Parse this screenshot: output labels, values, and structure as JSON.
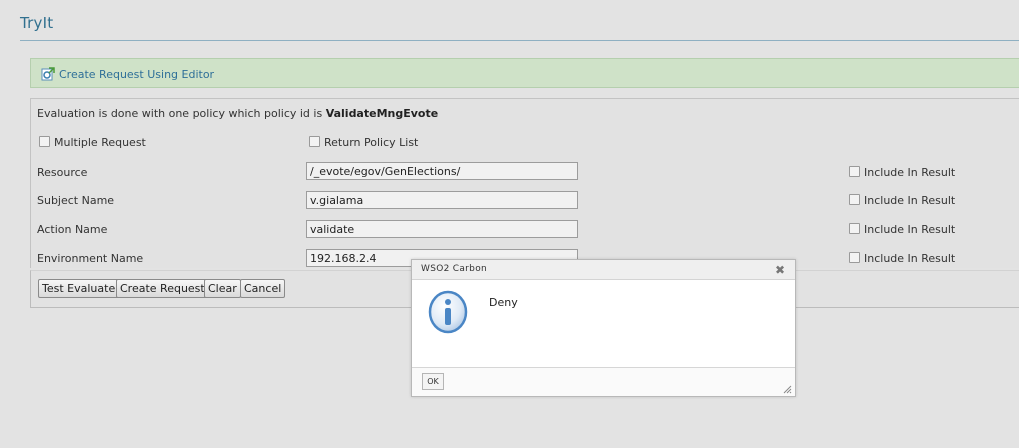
{
  "page": {
    "title": "TryIt"
  },
  "editor": {
    "link_label": "Create Request Using Editor",
    "icon": "edit-request-icon"
  },
  "form": {
    "info_prefix": "Evaluation is done with one policy which policy id is ",
    "policy_id": "ValidateMngEvote",
    "multiple_request_label": "Multiple Request",
    "return_policy_list_label": "Return Policy List",
    "include_label": "Include In Result",
    "fields": [
      {
        "label": "Resource",
        "value": "/_evote/egov/GenElections/"
      },
      {
        "label": "Subject Name",
        "value": "v.gialama"
      },
      {
        "label": "Action Name",
        "value": "validate"
      },
      {
        "label": "Environment Name",
        "value": "192.168.2.4"
      }
    ]
  },
  "actions": {
    "test_evaluate": "Test Evaluate",
    "create_request": "Create Request",
    "clear": "Clear",
    "cancel": "Cancel"
  },
  "dialog": {
    "title": "WSO2 Carbon",
    "close_glyph": "✖",
    "message": "Deny",
    "ok_label": "OK",
    "icon": "info-icon"
  },
  "colors": {
    "background": "#e3e3e3",
    "title": "#31708f",
    "editor_bar": "#cfe2c8",
    "link": "#2e6f98",
    "info_icon": "#4a86c5"
  }
}
